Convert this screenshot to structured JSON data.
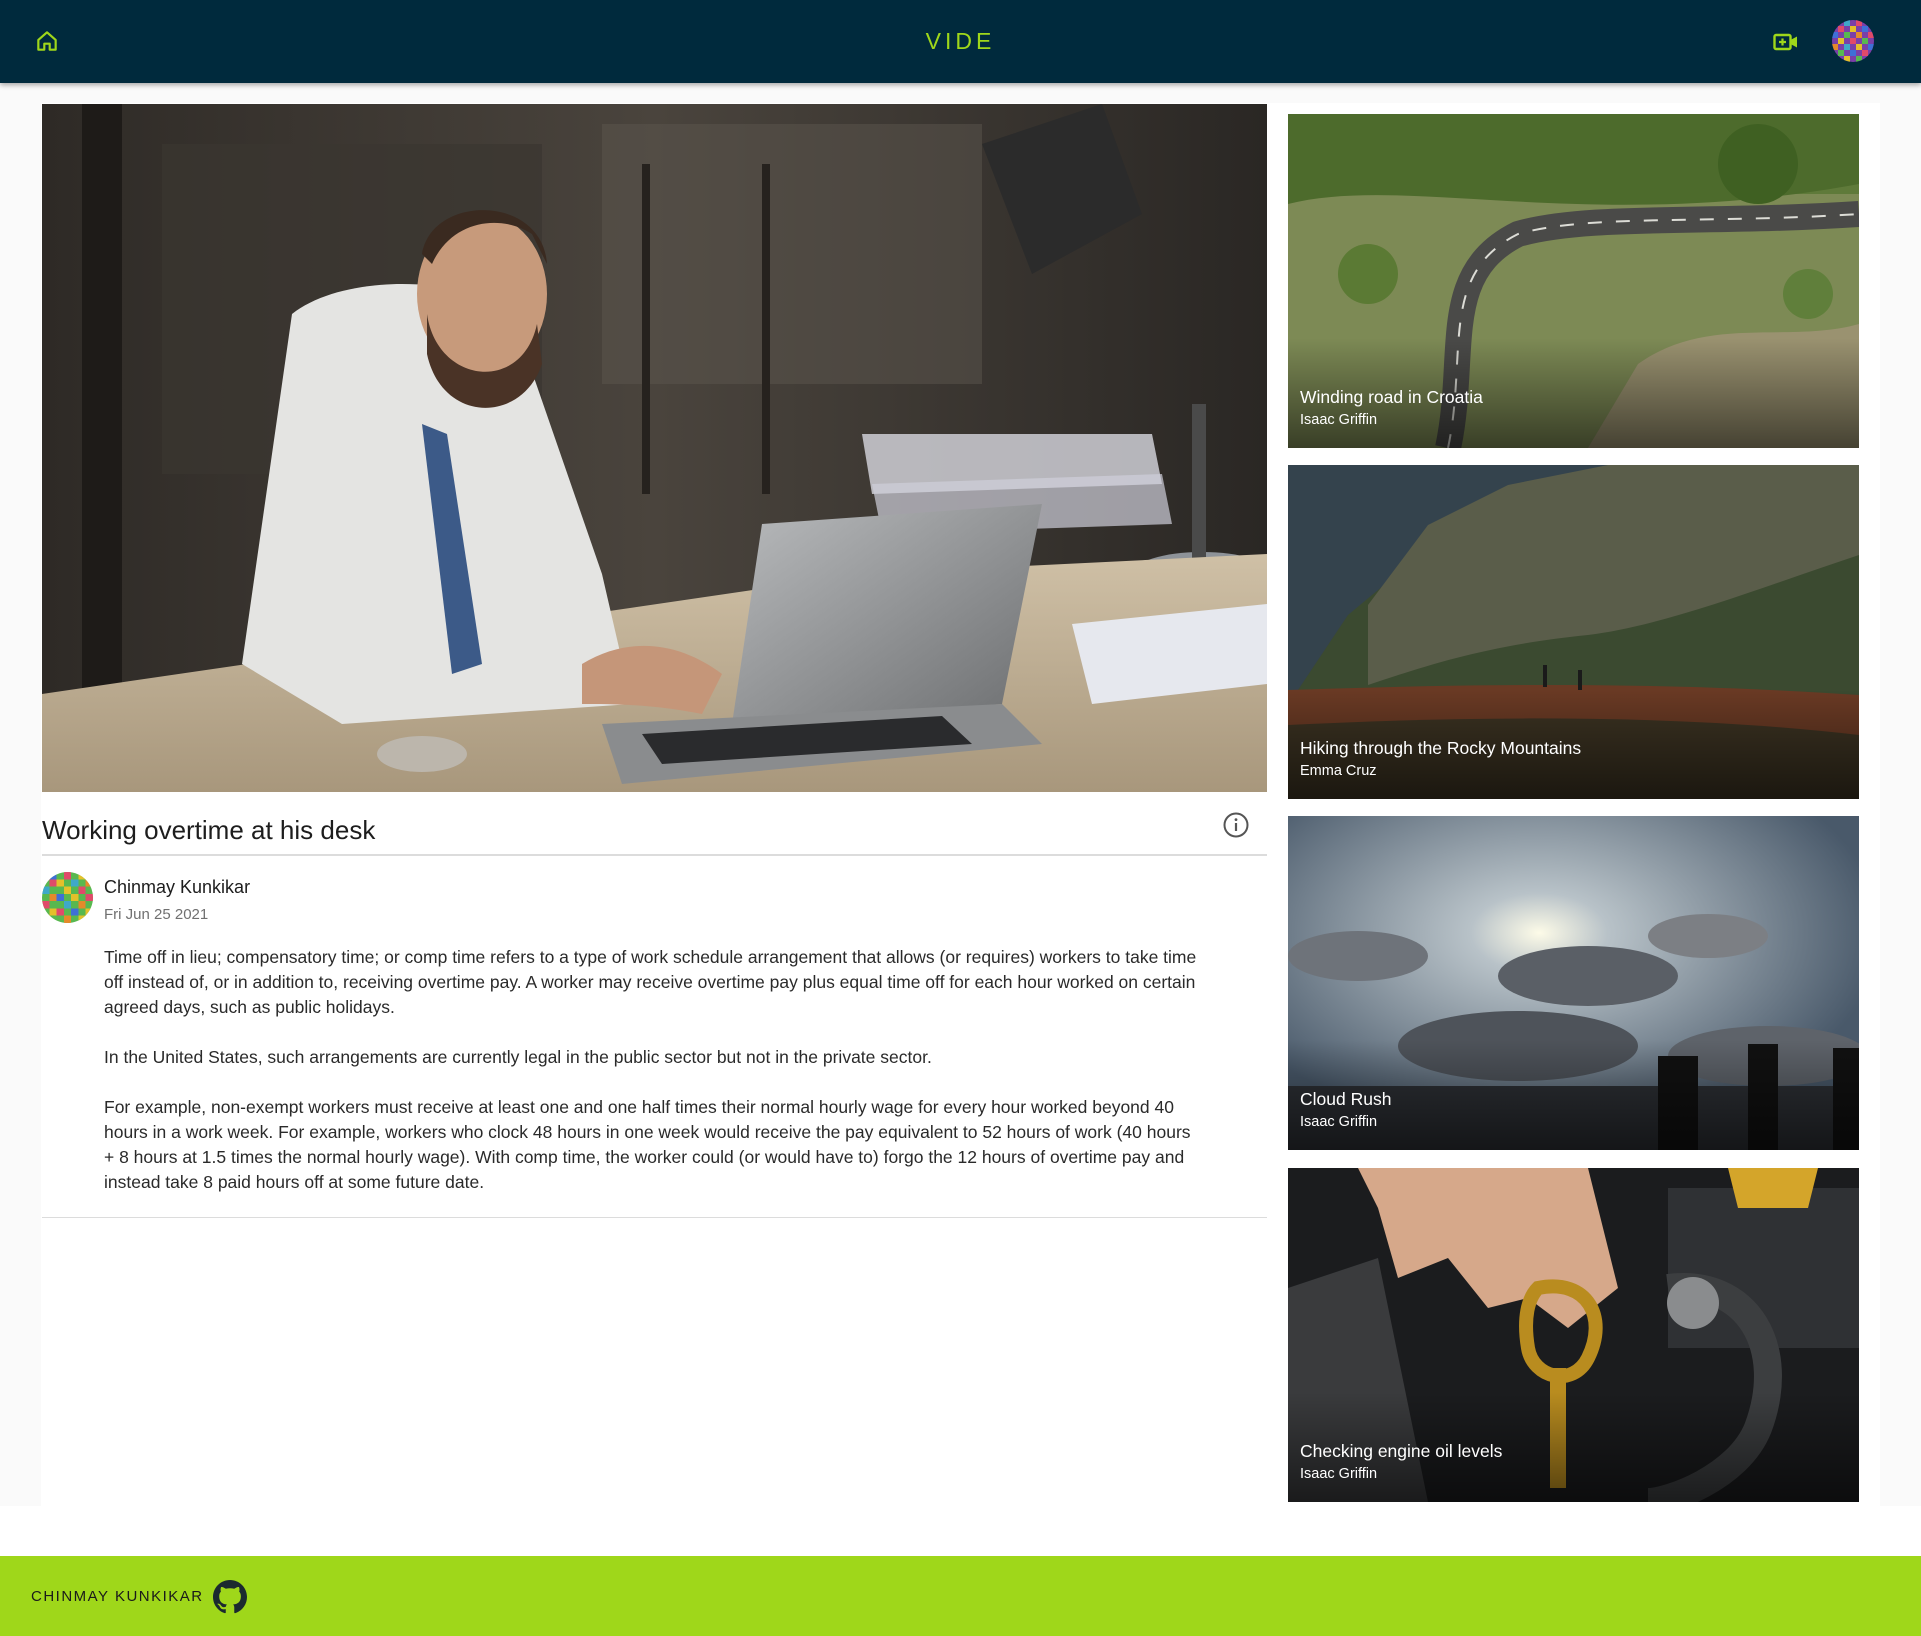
{
  "app": {
    "title": "VIDE",
    "accent_color": "#9fd71a",
    "appbar_color": "#002a3d"
  },
  "header": {
    "home_icon": "home-icon",
    "upload_icon": "video-add-icon",
    "avatar_icon": "user-avatar"
  },
  "video": {
    "title": "Working overtime at his desk",
    "info_icon": "info-icon",
    "author": "Chinmay Kunkikar",
    "date": "Fri Jun 25 2021",
    "description": [
      "Time off in lieu; compensatory time; or comp time refers to a type of work schedule arrangement that allows (or requires) workers to take time off instead of, or in addition to, receiving overtime pay. A worker may receive overtime pay plus equal time off for each hour worked on certain agreed days, such as public holidays.",
      "In the United States, such arrangements are currently legal in the public sector but not in the private sector.",
      "For example, non-exempt workers must receive at least one and one half times their normal hourly wage for every hour worked beyond 40 hours in a work week. For example, workers who clock 48 hours in one week would receive the pay equivalent to 52 hours of work (40 hours + 8 hours at 1.5 times the normal hourly wage). With comp time, the worker could (or would have to) forgo the 12 hours of overtime pay and instead take 8 paid hours off at some future date."
    ]
  },
  "related": [
    {
      "title": "Winding road in Croatia",
      "author": "Isaac Griffin"
    },
    {
      "title": "Hiking through the Rocky Mountains",
      "author": "Emma Cruz"
    },
    {
      "title": "Cloud Rush",
      "author": "Isaac Griffin"
    },
    {
      "title": "Checking engine oil levels",
      "author": "Isaac Griffin"
    }
  ],
  "footer": {
    "name": "CHINMAY KUNKIKAR",
    "github_icon": "github-icon"
  }
}
